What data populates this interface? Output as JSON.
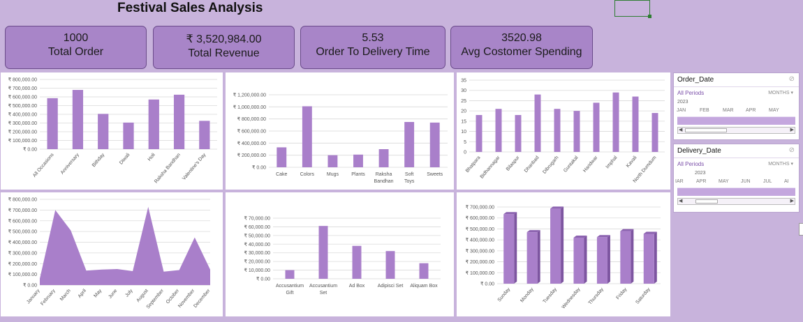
{
  "title": "Festival Sales Analysis",
  "kpis": [
    {
      "value": "1000",
      "label": "Total Order"
    },
    {
      "value": "₹ 3,520,984.00",
      "label": "Total Revenue"
    },
    {
      "value": "5.53",
      "label": "Order To Delivery Time"
    },
    {
      "value": "3520.98",
      "label": "Avg Costomer Spending"
    }
  ],
  "colors": {
    "bar": "#a97fca",
    "bar_dark": "#7d55a0",
    "background": "#c8b3dc",
    "card": "#a885c8"
  },
  "slicers": [
    {
      "title": "Order_Date",
      "all_periods": "All Periods",
      "level": "MONTHS",
      "year": "2023",
      "months": [
        "JAN",
        "FEB",
        "MAR",
        "APR",
        "MAY"
      ]
    },
    {
      "title": "Delivery_Date",
      "all_periods": "All Periods",
      "level": "MONTHS",
      "year": "2023",
      "months": [
        "IAR",
        "APR",
        "MAY",
        "JUN",
        "JUL",
        "AI"
      ]
    }
  ],
  "chart_data": [
    {
      "type": "bar",
      "categories": [
        "All Occasions",
        "Anniversary",
        "Bithday",
        "Diwali",
        "Holi",
        "Raksha Bandhan",
        "Valentine's Day"
      ],
      "values": [
        585000,
        680000,
        405000,
        305000,
        570000,
        625000,
        325000
      ],
      "yticks": [
        "₹ 0.00",
        "₹ 100,000.00",
        "₹ 200,000.00",
        "₹ 300,000.00",
        "₹ 400,000.00",
        "₹ 500,000.00",
        "₹ 600,000.00",
        "₹ 700,000.00",
        "₹ 800,000.00"
      ],
      "ylim": [
        0,
        800000
      ]
    },
    {
      "type": "bar",
      "categories": [
        "Cake",
        "Colors",
        "Mugs",
        "Plants",
        "Raksha Bandhan",
        "Soft Toys",
        "Sweets"
      ],
      "values": [
        330000,
        1010000,
        200000,
        210000,
        300000,
        750000,
        740000
      ],
      "yticks": [
        "₹ 0.00",
        "₹ 200,000.00",
        "₹ 400,000.00",
        "₹ 600,000.00",
        "₹ 800,000.00",
        "₹ 1,000,000.00",
        "₹ 1,200,000.00"
      ],
      "ylim": [
        0,
        1200000
      ]
    },
    {
      "type": "bar",
      "categories": [
        "Bhatpara",
        "Bidhannagar",
        "Bilaspur",
        "Dhanbad",
        "Dibrugarh",
        "Guntakal",
        "Haridwar",
        "Imphal",
        "Kavali",
        "North Dumdum"
      ],
      "values": [
        18,
        21,
        18,
        28,
        21,
        20,
        24,
        29,
        27,
        19
      ],
      "yticks": [
        "0",
        "5",
        "10",
        "15",
        "20",
        "25",
        "30",
        "35"
      ],
      "ylim": [
        0,
        35
      ]
    },
    {
      "type": "area",
      "categories": [
        "January",
        "February",
        "March",
        "April",
        "May",
        "June",
        "July",
        "August",
        "September",
        "October",
        "November",
        "December"
      ],
      "values": [
        60000,
        700000,
        510000,
        135000,
        145000,
        150000,
        130000,
        730000,
        125000,
        140000,
        445000,
        145000
      ],
      "yticks": [
        "₹ 0.00",
        "₹ 100,000.00",
        "₹ 200,000.00",
        "₹ 300,000.00",
        "₹ 400,000.00",
        "₹ 500,000.00",
        "₹ 600,000.00",
        "₹ 700,000.00",
        "₹ 800,000.00"
      ],
      "ylim": [
        0,
        800000
      ]
    },
    {
      "type": "bar",
      "categories": [
        "Accusantium Gift",
        "Accusantium Set",
        "Ad Box",
        "Adipisci Set",
        "Aliquam Box"
      ],
      "values": [
        10000,
        61000,
        38000,
        32000,
        18000
      ],
      "yticks": [
        "₹ 0.00",
        "₹ 10,000.00",
        "₹ 20,000.00",
        "₹ 30,000.00",
        "₹ 40,000.00",
        "₹ 50,000.00",
        "₹ 60,000.00",
        "₹ 70,000.00"
      ],
      "ylim": [
        0,
        70000
      ]
    },
    {
      "type": "bar",
      "categories": [
        "Sunday",
        "Monday",
        "Tuesday",
        "Wednesday",
        "Thursday",
        "Friday",
        "Saturday"
      ],
      "values": [
        635000,
        470000,
        685000,
        420000,
        425000,
        480000,
        455000
      ],
      "yticks": [
        "₹ 0.00",
        "₹ 100,000.00",
        "₹ 200,000.00",
        "₹ 300,000.00",
        "₹ 400,000.00",
        "₹ 500,000.00",
        "₹ 600,000.00",
        "₹ 700,000.00"
      ],
      "ylim": [
        0,
        700000
      ]
    }
  ]
}
